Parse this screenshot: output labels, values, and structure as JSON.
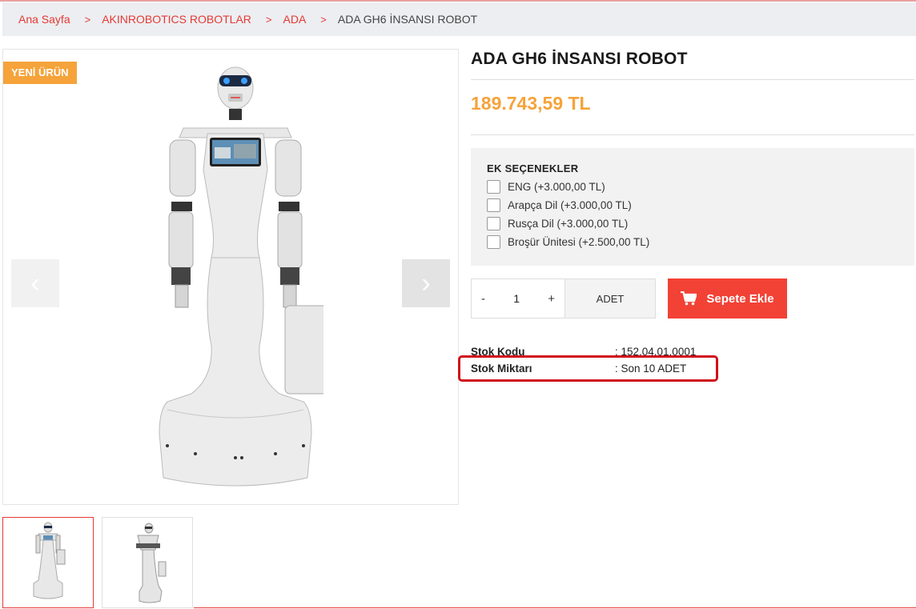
{
  "breadcrumb": {
    "items": [
      "Ana Sayfa",
      "AKINROBOTICS ROBOTLAR",
      "ADA"
    ],
    "current": "ADA GH6 İNSANSI ROBOT",
    "separator": ">"
  },
  "gallery": {
    "badge": "YENİ ÜRÜN",
    "prev_arrow": "‹",
    "next_arrow": "›"
  },
  "product": {
    "title": "ADA GH6 İNSANSI ROBOT",
    "price": "189.743,59 TL"
  },
  "options": {
    "title": "EK SEÇENEKLER",
    "items": [
      "ENG (+3.000,00 TL)",
      "Arapça Dil (+3.000,00 TL)",
      "Rusça Dil (+3.000,00 TL)",
      "Broşür Ünitesi (+2.500,00 TL)"
    ]
  },
  "quantity": {
    "minus": "-",
    "value": "1",
    "plus": "+",
    "unit": "ADET"
  },
  "cart": {
    "label": "Sepete Ekle"
  },
  "info": {
    "code_label": "Stok Kodu",
    "code_value": ": 152.04.01.0001",
    "stock_label": "Stok Miktarı",
    "stock_value": ": Son 10 ADET"
  },
  "colors": {
    "accent": "#e53935",
    "price": "#f5a33a",
    "cart_button": "#f24236",
    "highlight": "#d0111b"
  }
}
